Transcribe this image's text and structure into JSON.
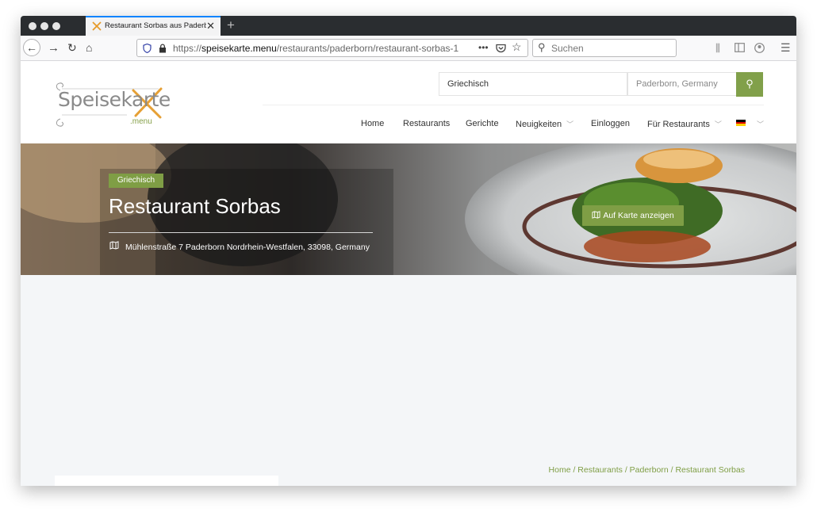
{
  "browser": {
    "tab_title": "Restaurant Sorbas aus Paderborn",
    "url_prefix": "https://",
    "url_domain": "speisekarte.menu",
    "url_path": "/restaurants/paderborn/restaurant-sorbas-1",
    "search_placeholder": "Suchen",
    "new_tab_label": "+",
    "close_tab_label": "✕"
  },
  "site": {
    "logo_word": "Speisekarte",
    "logo_suffix": ".menu",
    "search": {
      "query": "Griechisch",
      "location_placeholder": "Paderborn, Germany"
    },
    "nav": {
      "home": "Home",
      "restaurants": "Restaurants",
      "dishes": "Gerichte",
      "news": "Neuigkeiten",
      "login": "Einloggen",
      "for_restaurants": "Für Restaurants"
    }
  },
  "restaurant": {
    "category": "Griechisch",
    "name": "Restaurant Sorbas",
    "address": "Mühlenstraße 7 Paderborn Nordrhein-Westfalen, 33098, Germany",
    "map_button": "Auf Karte anzeigen"
  },
  "breadcrumb": "Home / Restaurants / Paderborn / Restaurant Sorbas",
  "colors": {
    "accent": "#7f9e45",
    "tab_highlight": "#0a84ff",
    "chrome_dark": "#2a2d30"
  }
}
